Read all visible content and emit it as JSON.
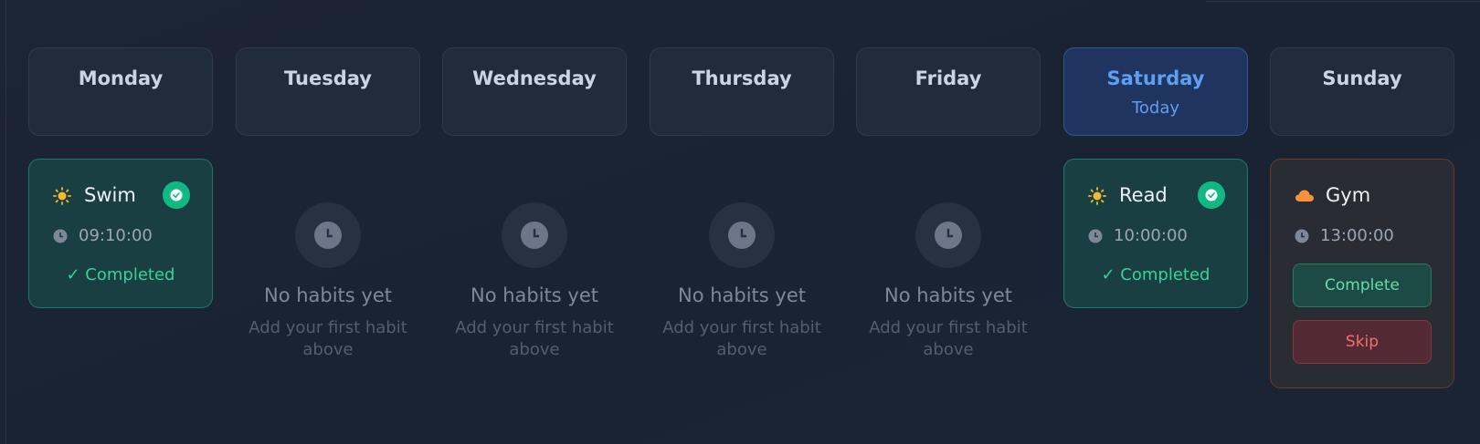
{
  "week": {
    "days": [
      {
        "name": "Monday",
        "today_label": null
      },
      {
        "name": "Tuesday",
        "today_label": null
      },
      {
        "name": "Wednesday",
        "today_label": null
      },
      {
        "name": "Thursday",
        "today_label": null
      },
      {
        "name": "Friday",
        "today_label": null
      },
      {
        "name": "Saturday",
        "today_label": "Today"
      },
      {
        "name": "Sunday",
        "today_label": null
      }
    ]
  },
  "habits": {
    "monday": {
      "name": "Swim",
      "time": "09:10:00",
      "status": "✓ Completed",
      "weather_icon": "sun-icon"
    },
    "saturday": {
      "name": "Read",
      "time": "10:00:00",
      "status": "✓ Completed",
      "weather_icon": "sun-icon"
    },
    "sunday": {
      "name": "Gym",
      "time": "13:00:00",
      "weather_icon": "cloud-icon",
      "complete_label": "Complete",
      "skip_label": "Skip"
    }
  },
  "empty_state": {
    "title": "No habits yet",
    "subtitle": "Add your first habit above"
  },
  "colors": {
    "today_accent": "#5d9ff0",
    "completed_green": "#10b981",
    "skip_red": "#f07070",
    "sun_yellow": "#f5b82e",
    "cloud_orange": "#f5923a"
  }
}
